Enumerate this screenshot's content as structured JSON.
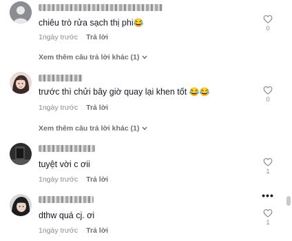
{
  "comments": [
    {
      "text": "chiêu trò rửa sạch thị phi",
      "emoji": "😂",
      "time": "1ngày trước",
      "reply": "Trả lời",
      "likes": "0",
      "more_replies": "Xem thêm câu trả lời khác (1)"
    },
    {
      "text": "trước thì chửi bây giờ quay lại khen tốt ",
      "emoji": "😂😂",
      "time": "1ngày trước",
      "reply": "Trả lời",
      "likes": "0",
      "more_replies": "Xem thêm câu trả lời khác (1)"
    },
    {
      "text": "tuyệt vời c ơii",
      "emoji": "",
      "time": "1ngày trước",
      "reply": "Trả lời",
      "likes": "1"
    },
    {
      "text": "dthw quá cj. ơi",
      "emoji": "",
      "time": "1ngày trước",
      "reply": "Trả lời",
      "likes": "1"
    }
  ],
  "icons": {
    "like": "heart-outline-icon",
    "more": "more-dots-icon",
    "expand": "chevron-down-icon"
  },
  "colors": {
    "text": "#161823",
    "secondary": "#8a8b91",
    "reply": "#6d6e75"
  }
}
